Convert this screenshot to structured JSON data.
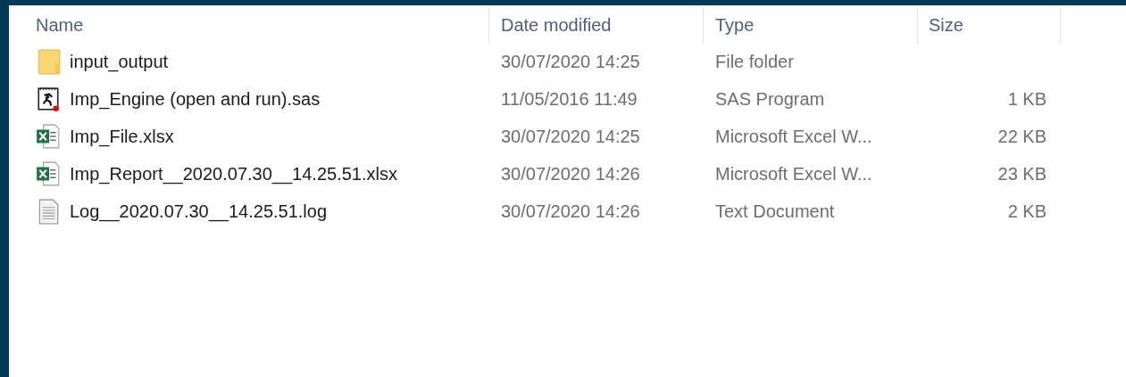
{
  "columns": [
    "Name",
    "Date modified",
    "Type",
    "Size"
  ],
  "files": [
    {
      "kind": "folder",
      "name": "input_output",
      "date_modified": "30/07/2020 14:25",
      "type": "File folder"
    },
    {
      "kind": "sas",
      "name": "Imp_Engine (open and run).sas",
      "date_modified": "11/05/2016 11:49",
      "type": "SAS Program",
      "size": "1 KB"
    },
    {
      "kind": "excel",
      "name": "Imp_File.xlsx",
      "date_modified": "30/07/2020 14:25",
      "type": "Microsoft Excel W...",
      "size": "22 KB"
    },
    {
      "kind": "excel",
      "name": "Imp_Report__2020.07.30__14.25.51.xlsx",
      "date_modified": "30/07/2020 14:26",
      "type": "Microsoft Excel W...",
      "size": "23 KB"
    },
    {
      "kind": "text",
      "name": "Log__2020.07.30__14.25.51.log",
      "date_modified": "30/07/2020 14:26",
      "type": "Text Document",
      "size": "2 KB"
    }
  ]
}
